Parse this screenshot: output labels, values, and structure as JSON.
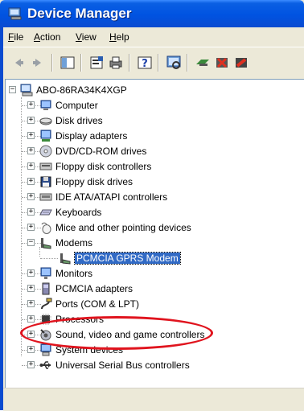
{
  "window": {
    "title": "Device Manager"
  },
  "menu": [
    {
      "label": "File",
      "accel": "F",
      "rest": "ile"
    },
    {
      "label": "Action",
      "accel": "A",
      "rest": "ction"
    },
    {
      "label": "View",
      "accel": "V",
      "rest": "iew"
    },
    {
      "label": "Help",
      "accel": "H",
      "rest": "elp"
    }
  ],
  "toolbar": [
    {
      "name": "back-icon"
    },
    {
      "name": "forward-icon"
    },
    {
      "name": "show-hide-tree-icon"
    },
    {
      "name": "properties-icon"
    },
    {
      "name": "print-icon"
    },
    {
      "name": "help-icon"
    },
    {
      "name": "scan-hardware-icon"
    },
    {
      "name": "update-driver-icon"
    },
    {
      "name": "uninstall-icon"
    },
    {
      "name": "disable-icon"
    }
  ],
  "tree": {
    "root": "ABO-86RA34K4XGP",
    "categories": [
      {
        "label": "Computer",
        "icon": "computer-icon",
        "expanded": false
      },
      {
        "label": "Disk drives",
        "icon": "disk-drive-icon",
        "expanded": false
      },
      {
        "label": "Display adapters",
        "icon": "display-adapter-icon",
        "expanded": false
      },
      {
        "label": "DVD/CD-ROM drives",
        "icon": "dvd-drive-icon",
        "expanded": false
      },
      {
        "label": "Floppy disk controllers",
        "icon": "floppy-controller-icon",
        "expanded": false
      },
      {
        "label": "Floppy disk drives",
        "icon": "floppy-drive-icon",
        "expanded": false
      },
      {
        "label": "IDE ATA/ATAPI controllers",
        "icon": "ide-controller-icon",
        "expanded": false
      },
      {
        "label": "Keyboards",
        "icon": "keyboard-icon",
        "expanded": false
      },
      {
        "label": "Mice and other pointing devices",
        "icon": "mouse-icon",
        "expanded": false
      },
      {
        "label": "Modems",
        "icon": "modem-icon",
        "expanded": true,
        "children": [
          {
            "label": "PCMCIA GPRS Modem",
            "icon": "modem-icon",
            "selected": true
          }
        ]
      },
      {
        "label": "Monitors",
        "icon": "monitor-icon",
        "expanded": false
      },
      {
        "label": "PCMCIA adapters",
        "icon": "pcmcia-icon",
        "expanded": false
      },
      {
        "label": "Ports (COM & LPT)",
        "icon": "port-icon",
        "expanded": false
      },
      {
        "label": "Processors",
        "icon": "processor-icon",
        "expanded": false
      },
      {
        "label": "Sound, video and game controllers",
        "icon": "sound-icon",
        "expanded": false
      },
      {
        "label": "System devices",
        "icon": "system-device-icon",
        "expanded": false
      },
      {
        "label": "Universal Serial Bus controllers",
        "icon": "usb-icon",
        "expanded": false
      }
    ]
  },
  "colors": {
    "titlebar": "#0053e1",
    "selection": "#316ac5",
    "annotation": "#e0141e"
  }
}
